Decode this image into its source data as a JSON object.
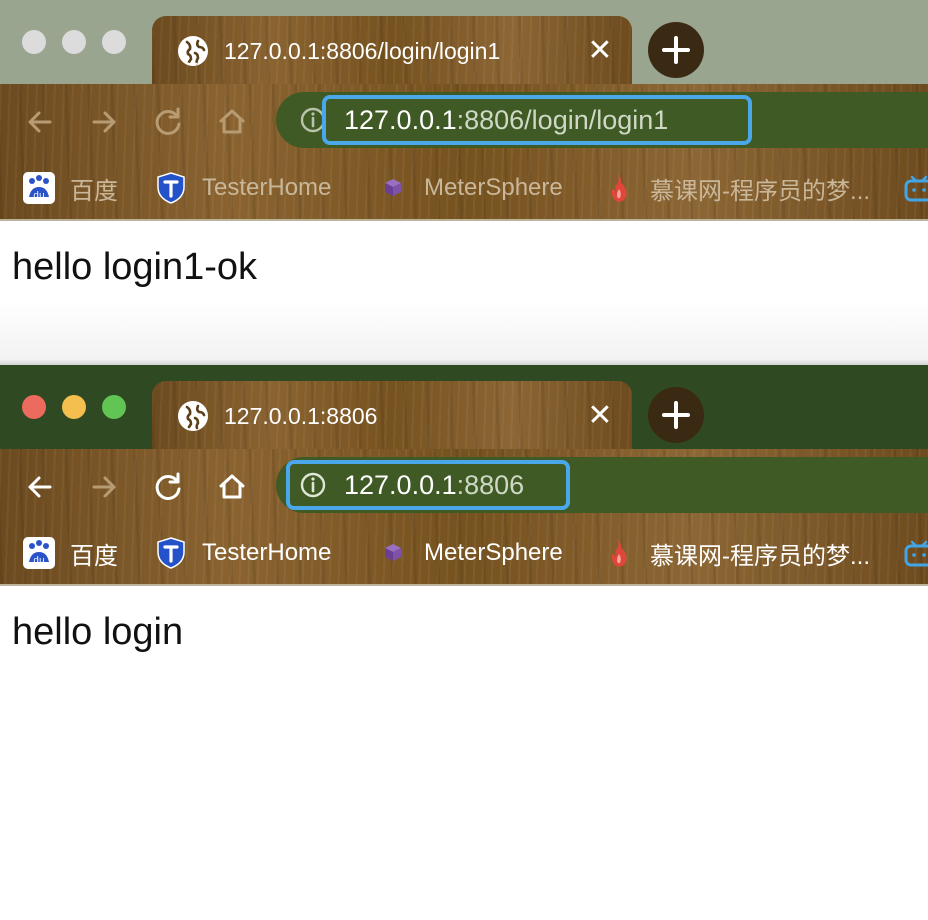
{
  "windows": [
    {
      "tab": {
        "title": "127.0.0.1:8806/login/login1",
        "close_glyph": "✕"
      },
      "address": {
        "host": "127.0.0.1",
        "rest": ":8806/login/login1"
      },
      "bookmarks": [
        {
          "label": "百度",
          "icon": "baidu-icon"
        },
        {
          "label": "TesterHome",
          "icon": "testerhome-shield-icon"
        },
        {
          "label": "MeterSphere",
          "icon": "metersphere-cube-icon"
        },
        {
          "label": "慕课网-程序员的梦...",
          "icon": "imooc-flame-icon"
        },
        {
          "label": "",
          "icon": "bilibili-tv-icon"
        }
      ],
      "page_text": "hello login1-ok",
      "state": "inactive"
    },
    {
      "tab": {
        "title": "127.0.0.1:8806",
        "close_glyph": "✕"
      },
      "address": {
        "host": "127.0.0.1",
        "rest": ":8806"
      },
      "bookmarks": [
        {
          "label": "百度",
          "icon": "baidu-icon"
        },
        {
          "label": "TesterHome",
          "icon": "testerhome-shield-icon"
        },
        {
          "label": "MeterSphere",
          "icon": "metersphere-cube-icon"
        },
        {
          "label": "慕课网-程序员的梦...",
          "icon": "imooc-flame-icon"
        },
        {
          "label": "",
          "icon": "bilibili-tv-icon"
        }
      ],
      "page_text": "hello login",
      "state": "active"
    }
  ],
  "colors": {
    "focus_ring": "#4aa8ea",
    "traffic_close": "#ec6a5e",
    "traffic_minimize": "#f4bf4f",
    "traffic_maximize": "#61c554",
    "inactive_traffic": "#dcdcdc",
    "omnibox_bg": "#3f5a25"
  }
}
